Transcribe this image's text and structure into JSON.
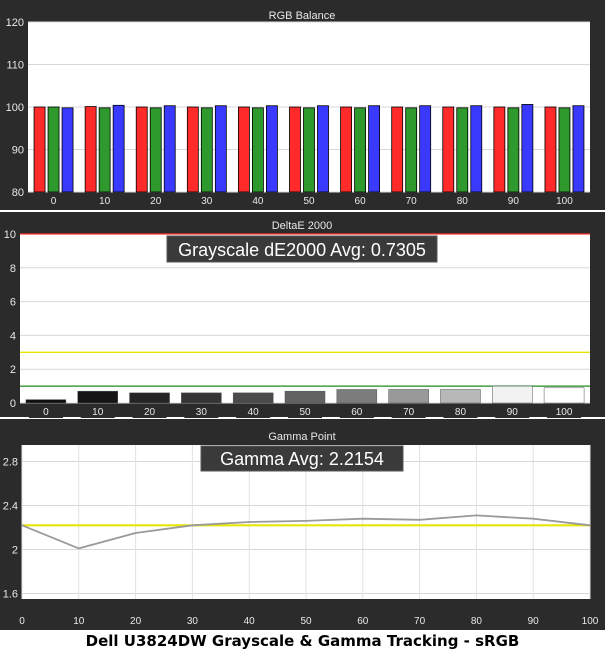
{
  "caption": "Dell U3824DW Grayscale & Gamma Tracking - sRGB",
  "colors": {
    "panel_bg": "#2b2b2b",
    "plot_bg": "#ffffff",
    "red": "#ff2a2a",
    "green": "#2e9a2e",
    "blue": "#3a3aff",
    "yellow": "#e6e600",
    "limit_red": "#ff3030",
    "dark_green": "#1f8a1f",
    "gamma_line": "#9a9a9a"
  },
  "chart_data": [
    {
      "type": "bar",
      "title": "RGB Balance",
      "categories": [
        "0",
        "10",
        "20",
        "30",
        "40",
        "50",
        "60",
        "70",
        "80",
        "90",
        "100"
      ],
      "series": [
        {
          "color": "red",
          "values": [
            100.0,
            100.1,
            100.0,
            100.0,
            100.0,
            100.0,
            100.0,
            100.0,
            100.0,
            100.0,
            100.0
          ]
        },
        {
          "color": "green",
          "values": [
            100.0,
            99.8,
            99.8,
            99.8,
            99.8,
            99.8,
            99.8,
            99.8,
            99.8,
            99.8,
            99.8
          ]
        },
        {
          "color": "blue",
          "values": [
            99.8,
            100.4,
            100.3,
            100.3,
            100.3,
            100.3,
            100.3,
            100.3,
            100.3,
            100.6,
            100.3
          ]
        }
      ],
      "ylim": [
        80,
        120
      ],
      "yticks": [
        80,
        90,
        100,
        110,
        120
      ]
    },
    {
      "type": "bar",
      "title": "DeltaE 2000",
      "annotation": "Grayscale dE2000 Avg: 0.7305",
      "categories": [
        "0",
        "10",
        "20",
        "30",
        "40",
        "50",
        "60",
        "70",
        "80",
        "90",
        "100"
      ],
      "values": [
        0.2,
        0.7,
        0.6,
        0.6,
        0.6,
        0.7,
        0.8,
        0.8,
        0.8,
        1.0,
        0.9
      ],
      "bar_colors": [
        "#101010",
        "#151515",
        "#242424",
        "#353535",
        "#4a4a4a",
        "#626262",
        "#7c7c7c",
        "#999999",
        "#b8b8b8",
        "#f2f2f2",
        "#ffffff"
      ],
      "reference_lines": [
        {
          "value": 10,
          "color": "limit_red"
        },
        {
          "value": 3,
          "color": "yellow"
        },
        {
          "value": 1,
          "color": "dark_green"
        }
      ],
      "ylim": [
        0,
        10
      ],
      "yticks": [
        0,
        2,
        4,
        6,
        8,
        10
      ]
    },
    {
      "type": "line",
      "title": "Gamma Point",
      "annotation": "Gamma Avg: 2.2154",
      "x": [
        0,
        10,
        20,
        30,
        40,
        50,
        60,
        70,
        80,
        90,
        100
      ],
      "values": [
        2.22,
        2.01,
        2.15,
        2.22,
        2.25,
        2.26,
        2.28,
        2.27,
        2.31,
        2.28,
        2.22
      ],
      "reference_value": 2.22,
      "xlim": [
        0,
        100
      ],
      "xticks": [
        0,
        10,
        20,
        30,
        40,
        50,
        60,
        70,
        80,
        90,
        100
      ],
      "ylim": [
        1.55,
        2.95
      ],
      "yticks": [
        1.6,
        2,
        2.4,
        2.8
      ],
      "ytick_labels": [
        "1.6",
        "2",
        "2.4",
        "2.8"
      ]
    }
  ]
}
